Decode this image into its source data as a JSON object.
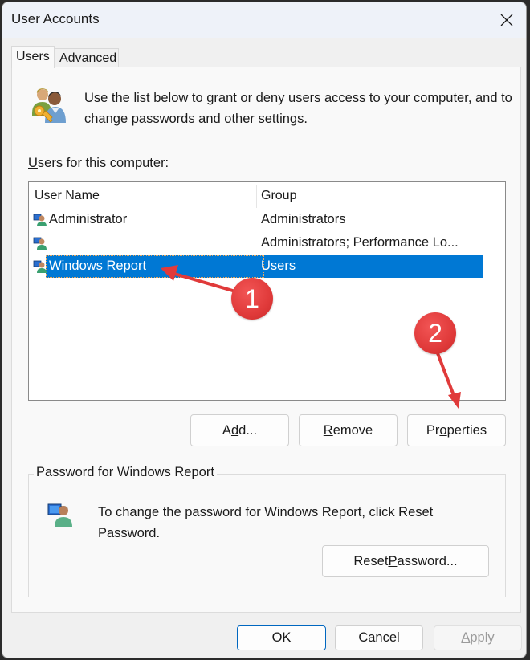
{
  "window": {
    "title": "User Accounts",
    "close_label": "Close"
  },
  "tabs": [
    {
      "label": "Users",
      "active": true
    },
    {
      "label": "Advanced",
      "active": false
    }
  ],
  "intro": {
    "text": "Use the list below to grant or deny users access to your computer, and to change passwords and other settings."
  },
  "users_list": {
    "label_accesskey": "U",
    "label_rest": "sers for this computer:",
    "columns": [
      "User Name",
      "Group"
    ],
    "rows": [
      {
        "name": "Administrator",
        "group": "Administrators",
        "selected": false
      },
      {
        "name": "",
        "group": "Administrators; Performance Lo...",
        "selected": false
      },
      {
        "name": "Windows Report",
        "group": "Users",
        "selected": true
      }
    ]
  },
  "list_buttons": {
    "add": {
      "pre": "A",
      "key": "d",
      "post": "d..."
    },
    "remove": {
      "pre": "",
      "key": "R",
      "post": "emove"
    },
    "properties": {
      "pre": "Pr",
      "key": "o",
      "post": "perties"
    }
  },
  "password_group": {
    "legend": "Password for Windows Report",
    "text": "To change the password for Windows Report, click Reset Password.",
    "reset_button": {
      "pre": "Reset ",
      "key": "P",
      "post": "assword..."
    }
  },
  "footer": {
    "ok": "OK",
    "cancel": "Cancel",
    "apply": {
      "pre": "",
      "key": "A",
      "post": "pply",
      "disabled": true
    }
  },
  "annotations": [
    {
      "number": "1",
      "points_to": "Windows Report"
    },
    {
      "number": "2",
      "points_to": "Properties"
    }
  ],
  "colors": {
    "selection": "#0078d4",
    "annotation_red": "#e03a3a",
    "default_button_border": "#0067c0"
  }
}
